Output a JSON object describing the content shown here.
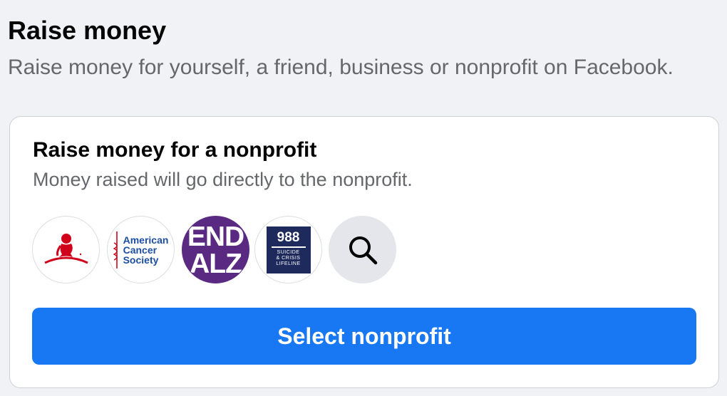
{
  "header": {
    "title": "Raise money",
    "subtitle": "Raise money for yourself, a friend, business or nonprofit on Facebook."
  },
  "card": {
    "title": "Raise money for a nonprofit",
    "description": "Money raised will go directly to the nonprofit.",
    "nonprofits": [
      {
        "name": "St. Jude Children's Research Hospital",
        "icon": "st-jude-logo",
        "color": "#d0021b"
      },
      {
        "name": "American Cancer Society",
        "logo_text": [
          "American",
          "Cancer",
          "Society"
        ],
        "icon": "american-cancer-society-logo",
        "color": "#1c4fa1"
      },
      {
        "name": "End Alz",
        "logo_text": [
          "END",
          "ALZ"
        ],
        "icon": "alzheimers-association-logo",
        "color": "#5a2a82"
      },
      {
        "name": "988 Suicide & Crisis Lifeline",
        "logo_text": [
          "988",
          "SUICIDE",
          "& CRISIS",
          "LIFELINE"
        ],
        "icon": "988-lifeline-logo",
        "color": "#1d2a5b"
      }
    ],
    "search_icon": "search-icon",
    "button_label": "Select nonprofit",
    "button_color": "#1877f2"
  }
}
